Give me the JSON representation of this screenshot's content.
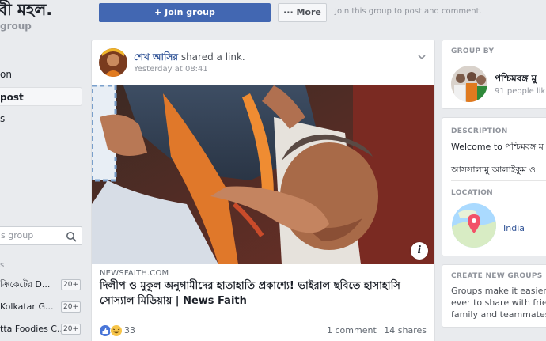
{
  "sidebar": {
    "group_title": "বী মহল.",
    "group_subtitle": "group",
    "nav": [
      {
        "label": "on"
      },
      {
        "label": "post"
      },
      {
        "label": "s"
      }
    ],
    "search_placeholder": "s group",
    "section_mark": "s",
    "groups": [
      {
        "name": "ক্রিকেটের D...",
        "count": "20+"
      },
      {
        "name": "Kolkatar G...",
        "count": "20+"
      },
      {
        "name": "tta Foodies C...",
        "count": "20+"
      }
    ]
  },
  "topbar": {
    "join_label": "+ Join group",
    "more_label": "··· More",
    "note": "Join this group to post and comment."
  },
  "post": {
    "author": "শেখ আসির",
    "action": "shared a link.",
    "timestamp": "Yesterday at 08:41",
    "domain": "NEWSFAITH.COM",
    "headline": "দিলীপ ও মুকুল অনুগামীদের হাতাহাতি প্রকাশ্যে! ভাইরাল ছবিতে হাসাহাসি সোস্যাল মিডিয়ায় | News Faith",
    "info_label": "i",
    "reaction_count": "33",
    "comments": "1 comment",
    "shares": "14 shares"
  },
  "right": {
    "group_by_heading": "GROUP BY",
    "group_by_name": "পশ্চিমবঙ্গ মু",
    "group_by_likes": "91 people lik",
    "description_heading": "DESCRIPTION",
    "description_line1": "Welcome to পশ্চিমবঙ্গ ম",
    "description_line2": "আসসালামু আলাইকুম ও",
    "location_heading": "LOCATION",
    "location_name": "India",
    "create_heading": "CREATE NEW GROUPS",
    "create_line1": "Groups make it easier t",
    "create_line2": "ever to share with friend",
    "create_line3": "family and teammates."
  },
  "colors": {
    "brand": "#4267b2",
    "link": "#365899",
    "background": "#e9ebee",
    "muted": "#90949c"
  },
  "icons": [
    "search-icon",
    "chevron-down-icon",
    "like-reaction-icon",
    "haha-reaction-icon",
    "info-icon",
    "map-pin-icon"
  ]
}
